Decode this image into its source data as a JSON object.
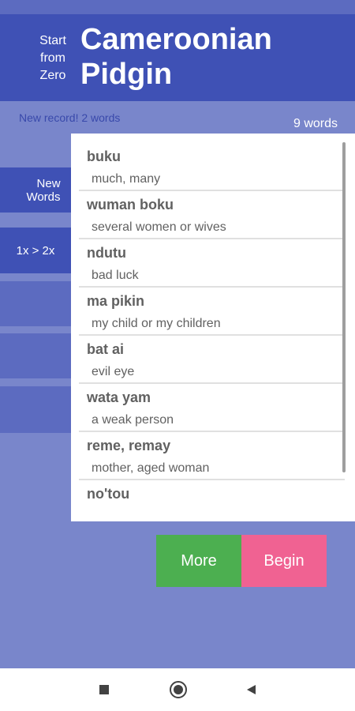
{
  "header": {
    "subtitle_lines": [
      "Start",
      "from",
      "Zero"
    ],
    "title_lines": [
      "Cameroonian",
      "Pidgin"
    ]
  },
  "record_text": "New record! 2 words",
  "word_count": "9 words",
  "menu": [
    {
      "label_lines": [
        "New",
        "Words"
      ]
    },
    {
      "label_lines": [
        "1x > 2x"
      ]
    }
  ],
  "words": [
    {
      "term": "buku",
      "definition": "much, many"
    },
    {
      "term": "wuman boku",
      "definition": "several women or wives"
    },
    {
      "term": "ndutu",
      "definition": "bad luck"
    },
    {
      "term": "ma pikin",
      "definition": "my child or my children"
    },
    {
      "term": "bat ai",
      "definition": "evil eye"
    },
    {
      "term": "wata yam",
      "definition": "a weak person"
    },
    {
      "term": "reme, remay",
      "definition": "mother, aged woman"
    },
    {
      "term": "no'tou",
      "definition": ""
    }
  ],
  "buttons": {
    "more": "More",
    "begin": "Begin"
  },
  "nav": {
    "recents_icon": "square-icon",
    "home_icon": "circle-icon",
    "back_icon": "triangle-back-icon"
  },
  "colors": {
    "background": "#7986cb",
    "header": "#3f51b5",
    "more": "#4caf50",
    "begin": "#f06292"
  }
}
